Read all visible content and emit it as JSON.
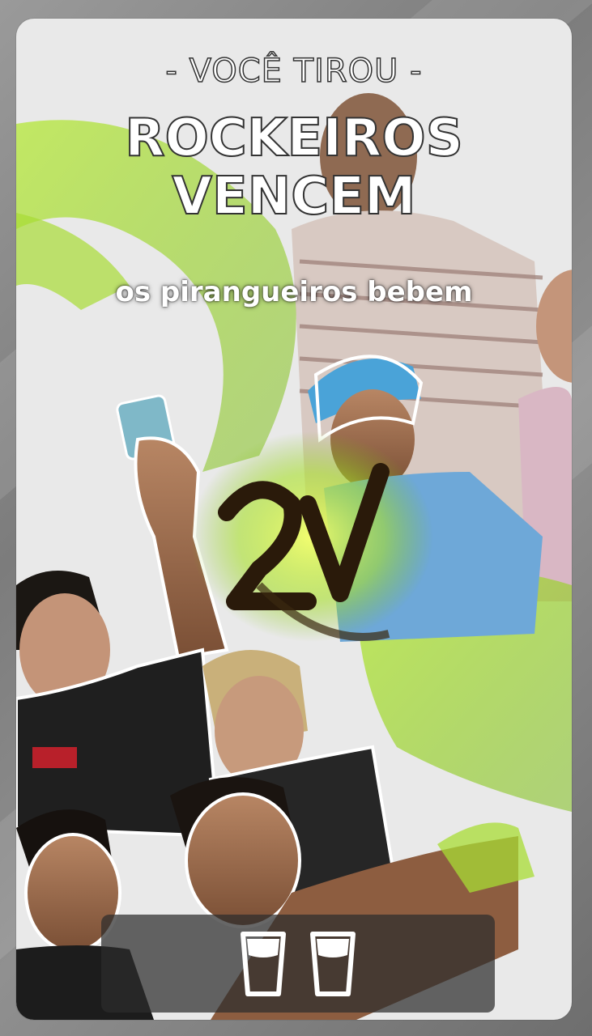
{
  "header": {
    "kicker": "- VOCÊ TIROU -",
    "title_line1": "ROCKEIROS",
    "title_line2": "VENCEM",
    "subtitle": "os pirangueiros bebem"
  },
  "footer": {
    "icons": [
      "cup-icon",
      "cup-icon"
    ]
  },
  "colors": {
    "accent_green": "#9ed62a",
    "card_bg": "#e9e9e9",
    "bar_bg": "#2d2d2d"
  }
}
